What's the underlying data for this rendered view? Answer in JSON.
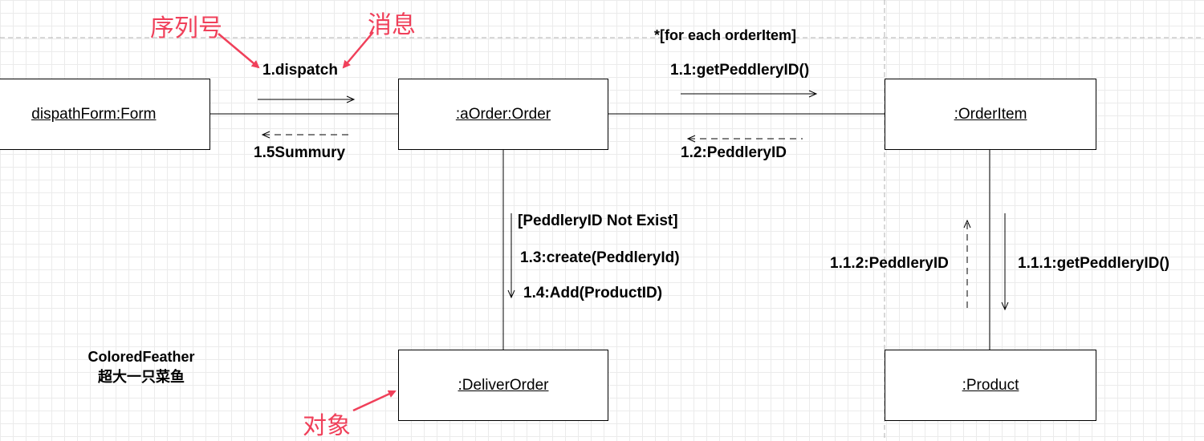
{
  "objects": {
    "dispath_form": ":dispathForm:Form",
    "a_order": ":aOrder:Order",
    "order_item": ":OrderItem",
    "deliver_order": ":DeliverOrder",
    "product": ":Product"
  },
  "messages": {
    "dispatch": "1.dispatch",
    "summury": "1.5Summury",
    "guard_for_each": "*[for each orderItem]",
    "get_peddlery_id": "1.1:getPeddleryID()",
    "peddlery_id_return": "1.2:PeddleryID",
    "guard_not_exist": "[PeddleryID Not Exist]",
    "create": "1.3:create(PeddleryId)",
    "add": "1.4:Add(ProductID)",
    "product_get_id": "1.1.1:getPeddleryID()",
    "product_return": "1.1.2:PeddleryID"
  },
  "annotations": {
    "sequence_number": "序列号",
    "message": "消息",
    "object": "对象"
  },
  "author_note": {
    "line1": "ColoredFeather",
    "line2": "超大一只菜鱼"
  },
  "colors": {
    "annotation": "#f0405a",
    "grid": "#ebebeb"
  }
}
